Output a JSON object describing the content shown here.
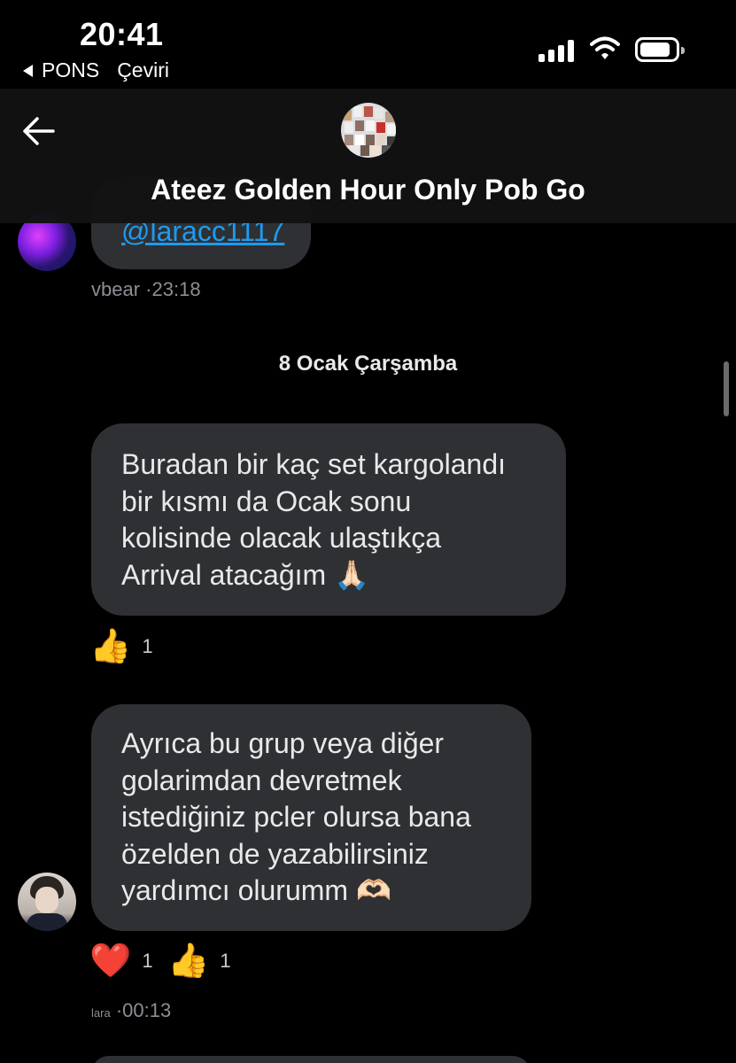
{
  "status_bar": {
    "time": "20:41",
    "back_app_label": "PONS",
    "back_app_action": "Çeviri",
    "icons": [
      "signal-icon",
      "wifi-icon",
      "battery-icon"
    ]
  },
  "header": {
    "title": "Ateez Golden Hour Only Pob Go",
    "back_icon": "arrow-left-icon"
  },
  "messages": [
    {
      "text": "@laracc1117",
      "sender": "vbear",
      "time": "·23:18"
    },
    {
      "date_divider": "8 Ocak Çarşamba"
    },
    {
      "text": "Buradan bir kaç set kargolandı\nbir kısmı da Ocak sonu\nkolisinde olacak ulaştıkça\nArrival atacağım 🙏🏻",
      "reactions": [
        {
          "emoji": "👍",
          "count": "1"
        }
      ]
    },
    {
      "text": "Ayrıca bu grup veya diğer\ngolarimdan devretmek\nistediğiniz pcler olursa bana\nözelden de yazabilirsiniz\nyardımcı olurumm 🫶🏻",
      "sender": "lara",
      "time": "·00:13",
      "reactions": [
        {
          "emoji": "❤️",
          "count": "1"
        },
        {
          "emoji": "👍",
          "count": "1"
        }
      ]
    }
  ],
  "colors": {
    "background": "#000000",
    "bubble": "#2f3033",
    "link": "#1d9bf0",
    "meta_text": "#8b8f95"
  }
}
